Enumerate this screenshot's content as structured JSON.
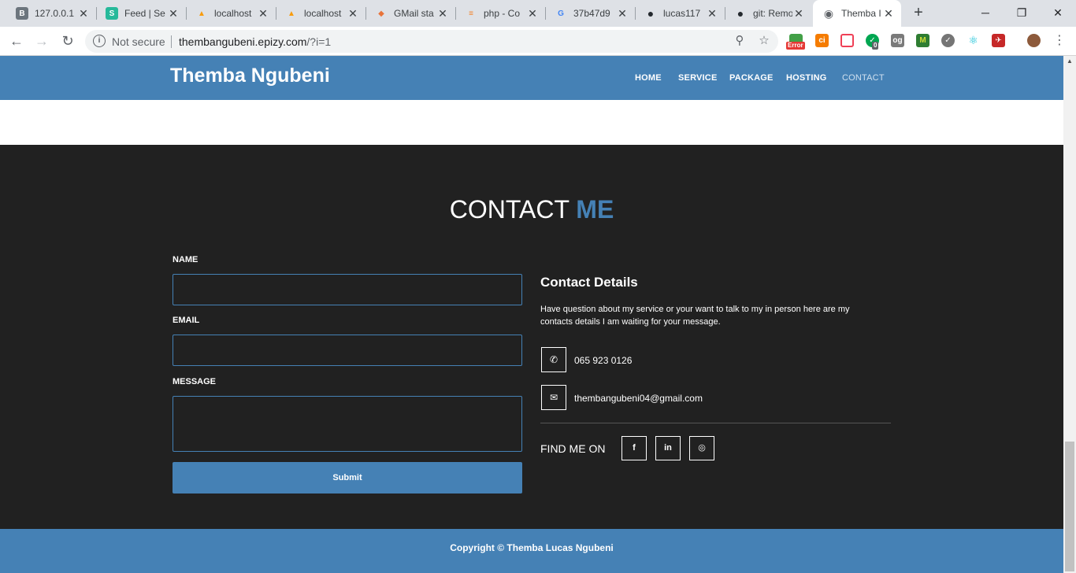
{
  "browser": {
    "tabs": [
      {
        "label": "127.0.0.1",
        "icon": "bootstrap-icon",
        "color": "#6c757d",
        "glyph": "B"
      },
      {
        "label": "Feed | Se",
        "icon": "sitepoint-icon",
        "color": "#26b99a",
        "glyph": "S"
      },
      {
        "label": "localhost",
        "icon": "phpmyadmin-icon",
        "color": "#f89c0e",
        "glyph": "▲"
      },
      {
        "label": "localhost",
        "icon": "phpmyadmin-icon",
        "color": "#f89c0e",
        "glyph": "▲"
      },
      {
        "label": "GMail sta",
        "icon": "stack-icon",
        "color": "#e8743b",
        "glyph": "◆"
      },
      {
        "label": "php - Co",
        "icon": "stackoverflow-icon",
        "color": "#f48024",
        "glyph": "≡"
      },
      {
        "label": "37b47d9",
        "icon": "google-icon",
        "color": "#4285f4",
        "glyph": "G"
      },
      {
        "label": "lucas117",
        "icon": "github-icon",
        "color": "#24292e",
        "glyph": "●"
      },
      {
        "label": "git: Remo",
        "icon": "github-icon",
        "color": "#24292e",
        "glyph": "●"
      },
      {
        "label": "Themba I",
        "icon": "globe-icon",
        "color": "#5f6368",
        "glyph": "◉",
        "active": true
      }
    ],
    "new_tab": "+",
    "address": {
      "security_label": "Not secure",
      "host": "thembangubeni.epizy.com",
      "path": "/?i=1"
    },
    "extensions": [
      {
        "name": "error-extension-icon",
        "color": "#43a047",
        "badge": "Error"
      },
      {
        "name": "orange-extension-icon",
        "color": "#f57c00"
      },
      {
        "name": "pocket-extension-icon",
        "color": "#ef4056"
      },
      {
        "name": "shield-extension-icon",
        "color": "#00a651",
        "badge": "0"
      },
      {
        "name": "og-extension-icon",
        "color": "#7a7a7a"
      },
      {
        "name": "m-extension-icon",
        "color": "#2e7d32"
      },
      {
        "name": "check-extension-icon",
        "color": "#757575"
      },
      {
        "name": "react-extension-icon",
        "color": "#00bcd4"
      },
      {
        "name": "red-shield-extension-icon",
        "color": "#c62828"
      }
    ]
  },
  "site": {
    "brand": "Themba Ngubeni",
    "menu": [
      "HOME",
      "SERVICE",
      "PACKAGE",
      "HOSTING",
      "CONTACT"
    ],
    "active_menu": "CONTACT",
    "colors": {
      "primary": "#4581b5",
      "dark": "#212121"
    }
  },
  "contact": {
    "heading_main": "CONTACT",
    "heading_accent": "ME",
    "form": {
      "name_label": "NAME",
      "name_value": "",
      "email_label": "EMAIL",
      "email_value": "",
      "message_label": "MESSAGE",
      "message_value": "",
      "submit_label": "Submit"
    },
    "details": {
      "title": "Contact Details",
      "description": "Have question about my service or your want to talk to my in person here are my contacts details I am waiting for your message.",
      "phone": "065 923 0126",
      "email": "thembangubeni04@gmail.com",
      "find_me": "FIND ME ON",
      "socials": [
        {
          "name": "facebook-icon",
          "glyph": "f"
        },
        {
          "name": "linkedin-icon",
          "glyph": "in"
        },
        {
          "name": "github-icon",
          "glyph": "◎"
        }
      ]
    }
  },
  "footer": {
    "copyright": "Copyright © Themba Lucas Ngubeni"
  }
}
